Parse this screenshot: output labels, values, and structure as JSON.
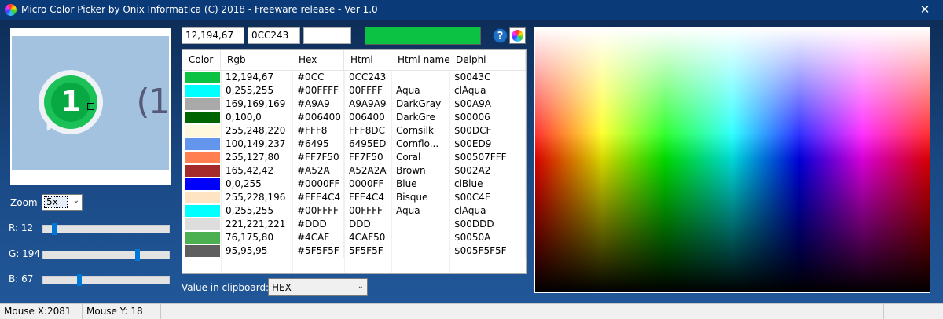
{
  "window": {
    "title": "Micro Color Picker by Onix Informatica (C) 2018 - Freeware release - Ver 1.0",
    "close_glyph": "✕"
  },
  "preview": {
    "zoomed_text": "(1",
    "badge_number": "1",
    "badge_color": "#08a843",
    "background_color": "#a3c2e0"
  },
  "zoom": {
    "label": "Zoom",
    "value": "5x"
  },
  "sliders": [
    {
      "label": "R: 12",
      "value": 12,
      "max": 255
    },
    {
      "label": "G: 194",
      "value": 194,
      "max": 255
    },
    {
      "label": "B: 67",
      "value": 67,
      "max": 255
    }
  ],
  "current": {
    "rgb": "12,194,67",
    "hex": "0CC243",
    "name": "",
    "color": "#0cc243"
  },
  "buttons": {
    "help_label": "?",
    "help_icon": "help-icon",
    "wheel_icon": "color-wheel-icon"
  },
  "table": {
    "columns": [
      "Color",
      "Rgb",
      "Hex",
      "Html",
      "Html name",
      "Delphi"
    ],
    "rows": [
      {
        "color": "#0cc243",
        "rgb": "12,194,67",
        "hex": "#0CC",
        "html": "0CC243",
        "name": "",
        "delphi": "$0043C"
      },
      {
        "color": "#00ffff",
        "rgb": "0,255,255",
        "hex": "#00FFFF",
        "html": "00FFFF",
        "name": "Aqua",
        "delphi": "clAqua"
      },
      {
        "color": "#a9a9a9",
        "rgb": "169,169,169",
        "hex": "#A9A9",
        "html": "A9A9A9",
        "name": "DarkGray",
        "delphi": "$00A9A"
      },
      {
        "color": "#006400",
        "rgb": "0,100,0",
        "hex": "#006400",
        "html": "006400",
        "name": "DarkGre",
        "delphi": "$00006"
      },
      {
        "color": "#fff8dc",
        "rgb": "255,248,220",
        "hex": "#FFF8",
        "html": "FFF8DC",
        "name": "Cornsilk",
        "delphi": "$00DCF"
      },
      {
        "color": "#6495ed",
        "rgb": "100,149,237",
        "hex": "#6495",
        "html": "6495ED",
        "name": "Cornflo...",
        "delphi": "$00ED9"
      },
      {
        "color": "#ff7f50",
        "rgb": "255,127,80",
        "hex": "#FF7F50",
        "html": "FF7F50",
        "name": "Coral",
        "delphi": "$00507FFF"
      },
      {
        "color": "#a52a2a",
        "rgb": "165,42,42",
        "hex": "#A52A",
        "html": "A52A2A",
        "name": "Brown",
        "delphi": "$002A2"
      },
      {
        "color": "#0000ff",
        "rgb": "0,0,255",
        "hex": "#0000FF",
        "html": "0000FF",
        "name": "Blue",
        "delphi": "clBlue"
      },
      {
        "color": "#ffe4c4",
        "rgb": "255,228,196",
        "hex": "#FFE4C4",
        "html": "FFE4C4",
        "name": "Bisque",
        "delphi": "$00C4E"
      },
      {
        "color": "#00ffff",
        "rgb": "0,255,255",
        "hex": "#00FFFF",
        "html": "00FFFF",
        "name": "Aqua",
        "delphi": "clAqua"
      },
      {
        "color": "#dddddd",
        "rgb": "221,221,221",
        "hex": "#DDD",
        "html": "DDD",
        "name": "",
        "delphi": "$00DDD"
      },
      {
        "color": "#4caf50",
        "rgb": "76,175,80",
        "hex": "#4CAF",
        "html": "4CAF50",
        "name": "",
        "delphi": "$0050A"
      },
      {
        "color": "#5f5f5f",
        "rgb": "95,95,95",
        "hex": "#5F5F5F",
        "html": "5F5F5F",
        "name": "",
        "delphi": "$005F5F5F"
      }
    ]
  },
  "clipboard": {
    "label": "Value in clipboard:",
    "value": "HEX"
  },
  "status": {
    "mouse_x": "Mouse X:2081",
    "mouse_y": "Mouse Y: 18"
  }
}
